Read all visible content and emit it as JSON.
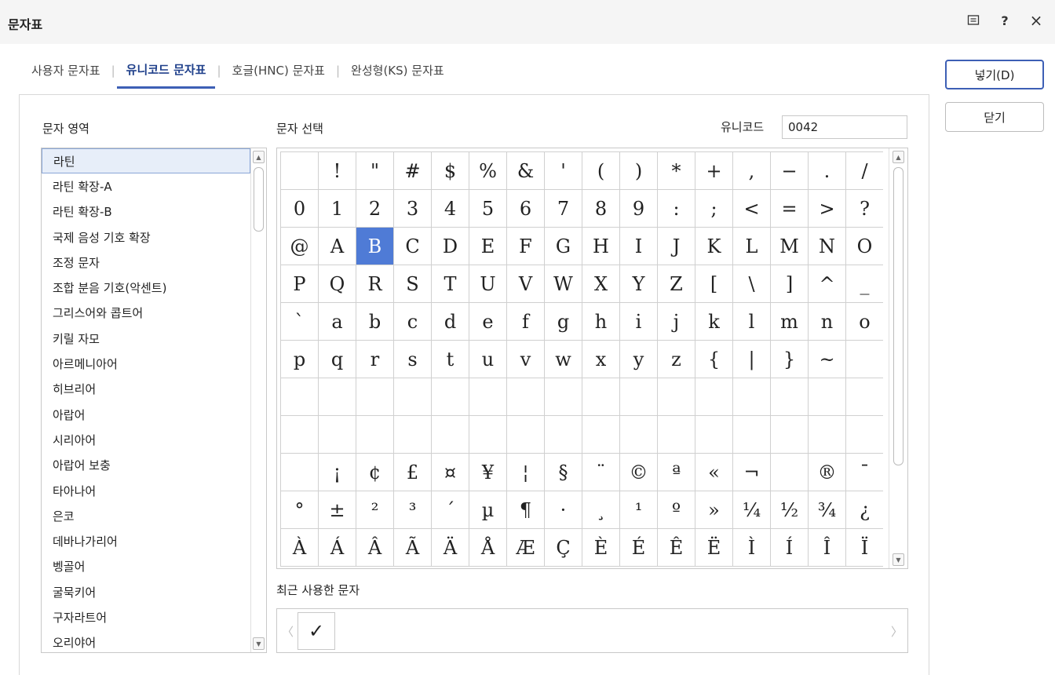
{
  "window": {
    "title": "문자표",
    "icons": [
      "window-mode-icon",
      "help-icon",
      "close-icon"
    ],
    "help_label": "?",
    "close_label": "×"
  },
  "tabs": [
    {
      "label": "사용자 문자표",
      "active": false
    },
    {
      "label": "유니코드 문자표",
      "active": true
    },
    {
      "label": "호글(HNC) 문자표",
      "active": false
    },
    {
      "label": "완성형(KS) 문자표",
      "active": false
    }
  ],
  "buttons": {
    "insert_label": "넣기(D)",
    "close_label": "닫기"
  },
  "area": {
    "label": "문자 영역",
    "items": [
      "라틴",
      "라틴 확장-A",
      "라틴 확장-B",
      "국제 음성 기호 확장",
      "조정 문자",
      "조합 분음 기호(악센트)",
      "그리스어와 콥트어",
      "키릴 자모",
      "아르메니아어",
      "히브리어",
      "아랍어",
      "시리아어",
      "아랍어 보충",
      "타아나어",
      "은코",
      "데바나가리어",
      "벵골어",
      "굴묵키어",
      "구자라트어",
      "오리야어"
    ],
    "selected_index": 0
  },
  "charsel": {
    "label": "문자 선택",
    "unicode_label": "유니코드",
    "unicode_value": "0042",
    "selected_char": "B",
    "rows": [
      [
        " ",
        "!",
        "\"",
        "#",
        "$",
        "%",
        "&",
        "'",
        "(",
        ")",
        "*",
        "+",
        ",",
        "−",
        ".",
        "/"
      ],
      [
        "0",
        "1",
        "2",
        "3",
        "4",
        "5",
        "6",
        "7",
        "8",
        "9",
        ":",
        ";",
        "<",
        "=",
        ">",
        "?"
      ],
      [
        "@",
        "A",
        "B",
        "C",
        "D",
        "E",
        "F",
        "G",
        "H",
        "I",
        "J",
        "K",
        "L",
        "M",
        "N",
        "O"
      ],
      [
        "P",
        "Q",
        "R",
        "S",
        "T",
        "U",
        "V",
        "W",
        "X",
        "Y",
        "Z",
        "[",
        "\\",
        "]",
        "^",
        "_"
      ],
      [
        "`",
        "a",
        "b",
        "c",
        "d",
        "e",
        "f",
        "g",
        "h",
        "i",
        "j",
        "k",
        "l",
        "m",
        "n",
        "o"
      ],
      [
        "p",
        "q",
        "r",
        "s",
        "t",
        "u",
        "v",
        "w",
        "x",
        "y",
        "z",
        "{",
        "|",
        "}",
        "~",
        ""
      ],
      [
        "",
        "",
        "",
        "",
        "",
        "",
        "",
        "",
        "",
        "",
        "",
        "",
        "",
        "",
        "",
        ""
      ],
      [
        "",
        "",
        "",
        "",
        "",
        "",
        "",
        "",
        "",
        "",
        "",
        "",
        "",
        "",
        "",
        ""
      ],
      [
        " ",
        "¡",
        "¢",
        "£",
        "¤",
        "¥",
        "¦",
        "§",
        "¨",
        "©",
        "ª",
        "«",
        "¬",
        "",
        "®",
        "¯"
      ],
      [
        "°",
        "±",
        "²",
        "³",
        "´",
        "µ",
        "¶",
        "·",
        "¸",
        "¹",
        "º",
        "»",
        "¼",
        "½",
        "¾",
        "¿"
      ],
      [
        "À",
        "Á",
        "Â",
        "Ã",
        "Ä",
        "Å",
        "Æ",
        "Ç",
        "È",
        "É",
        "Ê",
        "Ë",
        "Ì",
        "Í",
        "Î",
        "Ï"
      ]
    ]
  },
  "recent": {
    "label": "최근 사용한 문자",
    "chars": [
      "✓"
    ],
    "prev_label": "〈",
    "next_label": "〉"
  },
  "scroll_arrows": {
    "up": "▲",
    "down": "▼"
  }
}
